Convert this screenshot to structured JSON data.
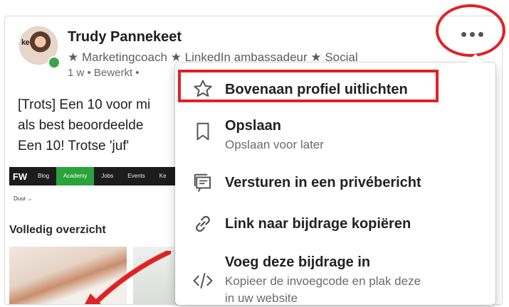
{
  "post": {
    "author_name": "Trudy Pannekeet",
    "headline": "★ Marketingcoach ★ LinkedIn ambassadeur ★ Social",
    "meta": "1 w • Bewerkt •",
    "text_lines": [
      "[Trots] Een 10 voor mi",
      "als best beoordeelde",
      "Een 10! Trotse 'juf'"
    ],
    "avatar_text": "ke"
  },
  "preview": {
    "logo": "FW",
    "nav": [
      "Blog",
      "Academy",
      "Jobs",
      "Events",
      "Ke"
    ],
    "active_nav": "Academy",
    "filter": "Duur",
    "title": "Volledig overzicht"
  },
  "menu": {
    "items": [
      {
        "icon": "star-icon",
        "title": "Bovenaan profiel uitlichten",
        "subtitle": ""
      },
      {
        "icon": "bookmark-icon",
        "title": "Opslaan",
        "subtitle": "Opslaan voor later"
      },
      {
        "icon": "message-icon",
        "title": "Versturen in een privébericht",
        "subtitle": ""
      },
      {
        "icon": "link-icon",
        "title": "Link naar bijdrage kopiëren",
        "subtitle": ""
      },
      {
        "icon": "code-icon",
        "title": "Voeg deze bijdrage in",
        "subtitle_lines": [
          "Kopieer de invoegcode en plak deze",
          "in uw website"
        ]
      }
    ]
  },
  "colors": {
    "annotation_red": "#e02222",
    "presence_green": "#3aa54a",
    "preview_active_green": "#2aa33a"
  }
}
